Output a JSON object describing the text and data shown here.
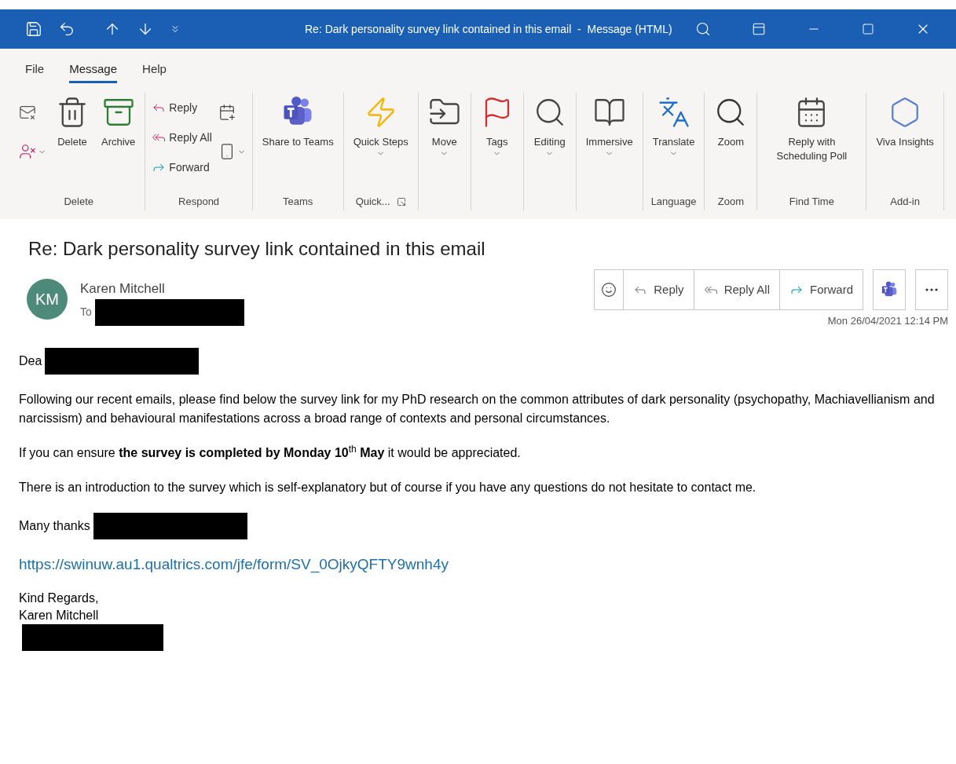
{
  "window": {
    "title": "Re: Dark personality survey link contained in this email  -  Message (HTML)"
  },
  "tabs": [
    {
      "label": "File",
      "selected": false
    },
    {
      "label": "Message",
      "selected": true
    },
    {
      "label": "Help",
      "selected": false
    }
  ],
  "ribbon": {
    "groups": [
      {
        "label": "Delete",
        "columns": [
          [
            {
              "kind": "icon",
              "dropdown": false
            },
            {
              "kind": "icon",
              "dropdown": true
            }
          ],
          [
            {
              "kind": "large",
              "label": "Delete",
              "dropdown": false
            }
          ],
          [
            {
              "kind": "large",
              "label": "Archive",
              "dropdown": false
            }
          ]
        ]
      },
      {
        "label": "Respond",
        "columns": [
          [
            {
              "kind": "small",
              "label": "Reply",
              "dropdown": false
            },
            {
              "kind": "small",
              "label": "Reply All",
              "dropdown": false
            },
            {
              "kind": "small",
              "label": "Forward",
              "dropdown": false
            }
          ],
          [
            {
              "kind": "icon",
              "dropdown": false
            },
            {
              "kind": "icon",
              "dropdown": true
            }
          ]
        ]
      },
      {
        "label": "Teams",
        "columns": [
          [
            {
              "kind": "large",
              "label": "Share to Teams",
              "dropdown": false
            }
          ]
        ]
      },
      {
        "label": "Quick...",
        "launcher": true,
        "columns": [
          [
            {
              "kind": "large",
              "label": "Quick Steps",
              "dropdown": true
            }
          ]
        ]
      },
      {
        "columns": [
          [
            {
              "kind": "large",
              "label": "Move",
              "dropdown": true
            }
          ]
        ]
      },
      {
        "columns": [
          [
            {
              "kind": "large",
              "label": "Tags",
              "dropdown": true
            }
          ]
        ]
      },
      {
        "columns": [
          [
            {
              "kind": "large",
              "label": "Editing",
              "dropdown": true
            }
          ]
        ]
      },
      {
        "columns": [
          [
            {
              "kind": "large",
              "label": "Immersive",
              "dropdown": true
            }
          ]
        ]
      },
      {
        "label": "Language",
        "columns": [
          [
            {
              "kind": "large",
              "label": "Translate",
              "dropdown": true
            }
          ]
        ]
      },
      {
        "label": "Zoom",
        "columns": [
          [
            {
              "kind": "large",
              "label": "Zoom",
              "dropdown": false
            }
          ]
        ]
      },
      {
        "label": "Find Time",
        "columns": [
          [
            {
              "kind": "large",
              "label": "Reply with Scheduling Poll",
              "dropdown": false
            }
          ]
        ]
      },
      {
        "label": "Add-in",
        "columns": [
          [
            {
              "kind": "large",
              "label": "Viva Insights",
              "dropdown": false
            }
          ]
        ]
      }
    ]
  },
  "message": {
    "subject": "Re: Dark personality survey link contained in this email",
    "sender": {
      "initials": "KM",
      "name": "Karen Mitchell",
      "to_label": "To"
    },
    "actions": [
      {
        "kind": "icon"
      },
      {
        "kind": "text",
        "label": "Reply"
      },
      {
        "kind": "text",
        "label": "Reply All"
      },
      {
        "kind": "text",
        "label": "Forward"
      }
    ],
    "date": "Mon 26/04/2021 12:14 PM",
    "body": [
      {
        "kind": "redacted",
        "text": "Dea"
      },
      {
        "kind": "text",
        "text": "Following our recent emails, please find below the survey link for my PhD research on the common attributes of dark personality (psychopathy, Machiavellianism and narcissism) and behavioural manifestations across a broad range of contexts and personal circumstances."
      },
      {
        "kind": "text",
        "text": "If you can ensure **the survey is completed by Monday 10**$^{th}$ **May** it would be appreciated."
      },
      {
        "kind": "text",
        "text": "There is an introduction to the survey which is self-explanatory but of course if you have any questions do not hesitate to contact me."
      },
      {
        "kind": "redacted",
        "text": "Many thanks"
      },
      {
        "kind": "link",
        "text": "https://swinuw.au1.qualtrics.com/jfe/form/SV_0OjkyQFTY9wnh4y"
      }
    ],
    "signature": [
      "Kind Regards,",
      "Karen Mitchell"
    ]
  }
}
